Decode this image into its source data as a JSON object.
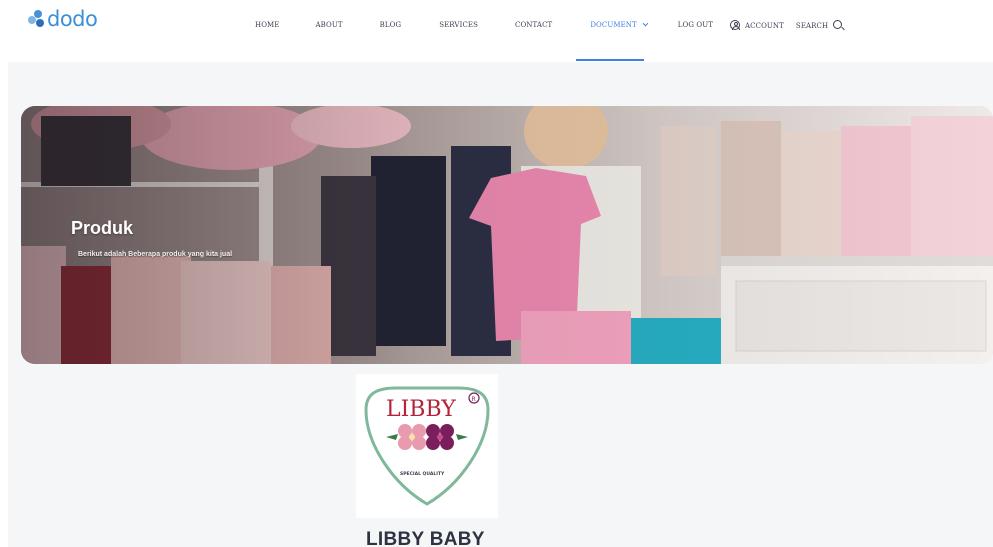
{
  "brand": {
    "logo_text": "dodo"
  },
  "nav": {
    "items": [
      {
        "label": "HOME"
      },
      {
        "label": "ABOUT"
      },
      {
        "label": "BLOG"
      },
      {
        "label": "SERVICES"
      },
      {
        "label": "CONTACT"
      },
      {
        "label": "DOCUMENT"
      },
      {
        "label": "LOG OUT"
      },
      {
        "label": "ACCOUNT"
      },
      {
        "label": "SEARCH"
      }
    ],
    "active": "DOCUMENT"
  },
  "hero": {
    "title": "Produk",
    "subtitle": "Berikut adalah Beberapa produk yang kita jual"
  },
  "products": [
    {
      "logo_text": "LIBBY",
      "registered_mark": "®",
      "logo_tagline": "SPECIAL QUALITY",
      "name": "LIBBY BABY"
    }
  ],
  "colors": {
    "accent": "#3d7fe6",
    "logo_blue": "#3d8fd6",
    "libby_red": "#b3243a",
    "libby_purple": "#7a1e5c",
    "libby_pink": "#e89aae",
    "badge_green": "#7fb89a"
  },
  "icons": [
    "user-circle-icon",
    "search-icon",
    "chevron-down-icon"
  ]
}
